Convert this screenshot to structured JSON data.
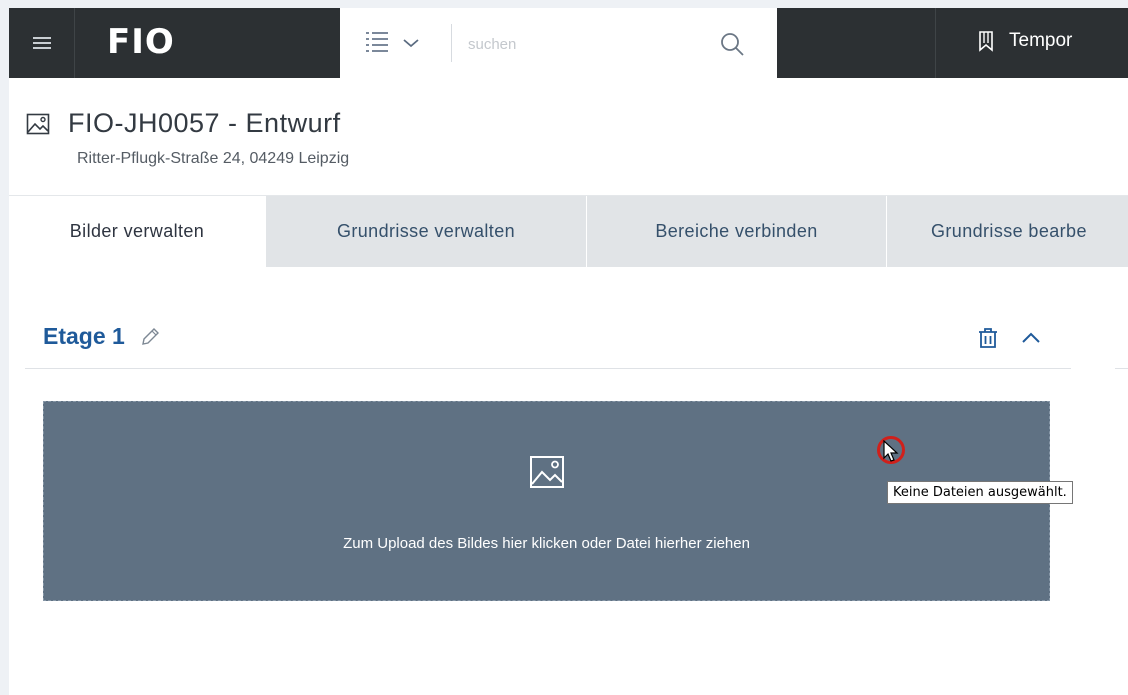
{
  "topbar": {
    "logo_text": "FIO",
    "search": {
      "placeholder": "suchen",
      "type_icon": "list-icon",
      "dropdown_icon": "chevron-down-icon",
      "search_icon": "search-icon"
    },
    "bookmark": {
      "icon": "bookmark-icon",
      "label": "Tempor"
    },
    "background_color": "#2c3033"
  },
  "header": {
    "title_icon": "image-icon",
    "title": "FIO-JH0057 - Entwurf",
    "address": "Ritter-Pflugk-Straße 24, 04249 Leipzig"
  },
  "tabs": [
    {
      "label": "Bilder verwalten",
      "active": true
    },
    {
      "label": "Grundrisse verwalten",
      "active": false
    },
    {
      "label": "Bereiche verbinden",
      "active": false
    },
    {
      "label": "Grundrisse bearbe",
      "active": false
    }
  ],
  "floor": {
    "title": "Etage 1",
    "edit_icon": "pencil-icon",
    "delete_icon": "trash-icon",
    "collapse_icon": "chevron-up-icon",
    "title_color": "#1f5a9a"
  },
  "upload": {
    "icon": "image-icon",
    "text": "Zum Upload des Bildes hier klicken oder Datei hierher ziehen",
    "background_color": "#5f7183"
  },
  "tooltip": {
    "text": "Keine Dateien ausgewählt."
  }
}
